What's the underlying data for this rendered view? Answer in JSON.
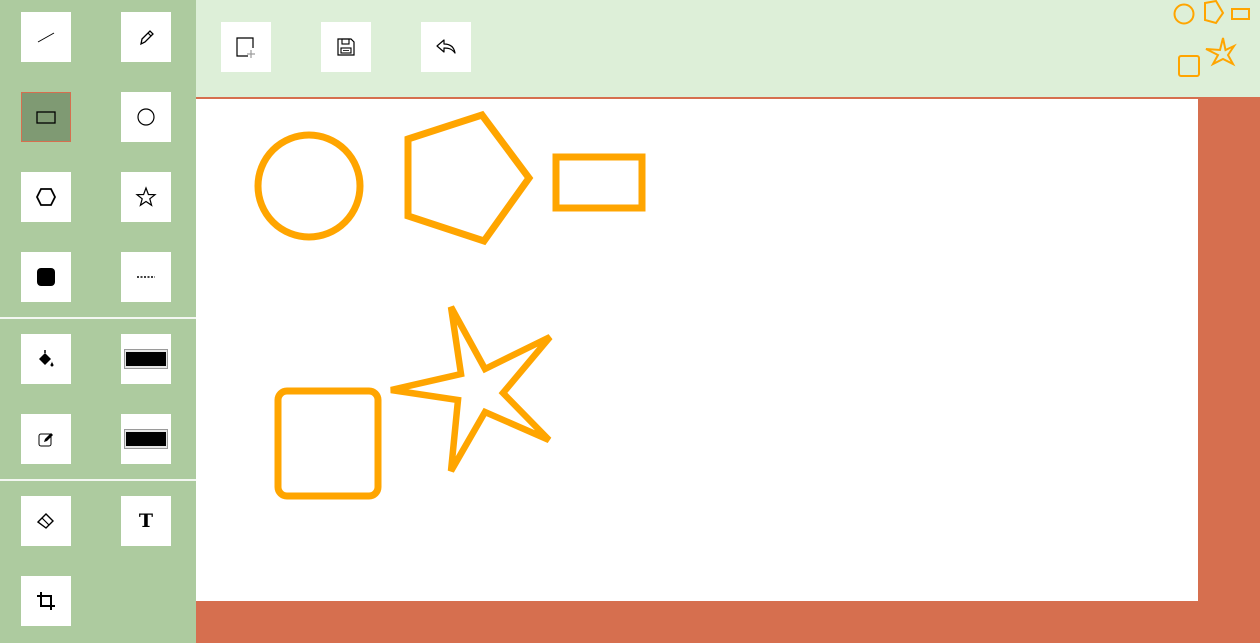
{
  "app": {
    "brand_color": "#d66f4f",
    "sidebar_color": "#adcb9f",
    "toolbar_color": "#ddefd8",
    "shape_stroke_color": "#ffa500",
    "logo_icon": "shapes-logo-icon"
  },
  "sidebar": {
    "draw_tools": [
      {
        "id": "line",
        "icon": "line-icon",
        "active": false
      },
      {
        "id": "pencil",
        "icon": "pencil-icon",
        "active": false
      },
      {
        "id": "rectangle",
        "icon": "rectangle-icon",
        "active": true
      },
      {
        "id": "circle",
        "icon": "circle-icon",
        "active": false
      },
      {
        "id": "hexagon",
        "icon": "hexagon-icon",
        "active": false
      },
      {
        "id": "star",
        "icon": "star-icon",
        "active": false
      },
      {
        "id": "rounded-square",
        "icon": "rounded-square-icon",
        "active": false
      },
      {
        "id": "dashed-line",
        "icon": "dashed-line-icon",
        "active": false
      }
    ],
    "color_tools": {
      "fill_icon": "paint-bucket-icon",
      "fill_color": "#000000",
      "stroke_icon": "edit-stroke-icon",
      "stroke_color": "#000000"
    },
    "misc_tools": {
      "eraser_icon": "eraser-icon",
      "text_icon": "text-icon",
      "text_label": "T",
      "crop_icon": "crop-icon"
    }
  },
  "toolbar": {
    "buttons": [
      {
        "id": "new",
        "icon": "new-canvas-icon"
      },
      {
        "id": "save",
        "icon": "save-icon"
      },
      {
        "id": "undo",
        "icon": "undo-icon"
      }
    ]
  },
  "canvas": {
    "shapes": [
      {
        "type": "circle",
        "stroke": "#ffa500"
      },
      {
        "type": "pentagon",
        "stroke": "#ffa500"
      },
      {
        "type": "rectangle",
        "stroke": "#ffa500"
      },
      {
        "type": "star",
        "stroke": "#ffa500"
      },
      {
        "type": "rounded-square",
        "stroke": "#ffa500"
      }
    ]
  }
}
